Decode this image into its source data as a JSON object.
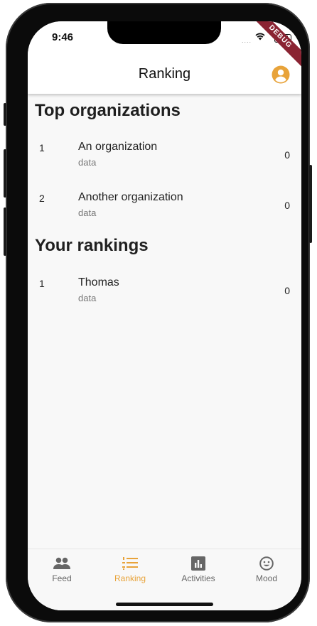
{
  "status_bar": {
    "time": "9:46",
    "signal": "....",
    "debug_banner": "DEBUG"
  },
  "appbar": {
    "title": "Ranking",
    "profile_icon": "account-circle-icon",
    "accent": "#e8a33a"
  },
  "sections": [
    {
      "title": "Top organizations",
      "rows": [
        {
          "rank": "1",
          "name": "An organization",
          "subtitle": "data",
          "score": "0"
        },
        {
          "rank": "2",
          "name": "Another organization",
          "subtitle": "data",
          "score": "0"
        }
      ]
    },
    {
      "title": "Your rankings",
      "rows": [
        {
          "rank": "1",
          "name": "Thomas",
          "subtitle": "data",
          "score": "0"
        }
      ]
    }
  ],
  "tabs": [
    {
      "label": "Feed",
      "icon": "people-icon",
      "active": false
    },
    {
      "label": "Ranking",
      "icon": "ranking-list-icon",
      "active": true
    },
    {
      "label": "Activities",
      "icon": "bar-chart-icon",
      "active": false
    },
    {
      "label": "Mood",
      "icon": "smiley-icon",
      "active": false
    }
  ],
  "colors": {
    "active_tab": "#e8a33a",
    "inactive_tab": "#666666",
    "debug_banner": "#8a2332"
  }
}
